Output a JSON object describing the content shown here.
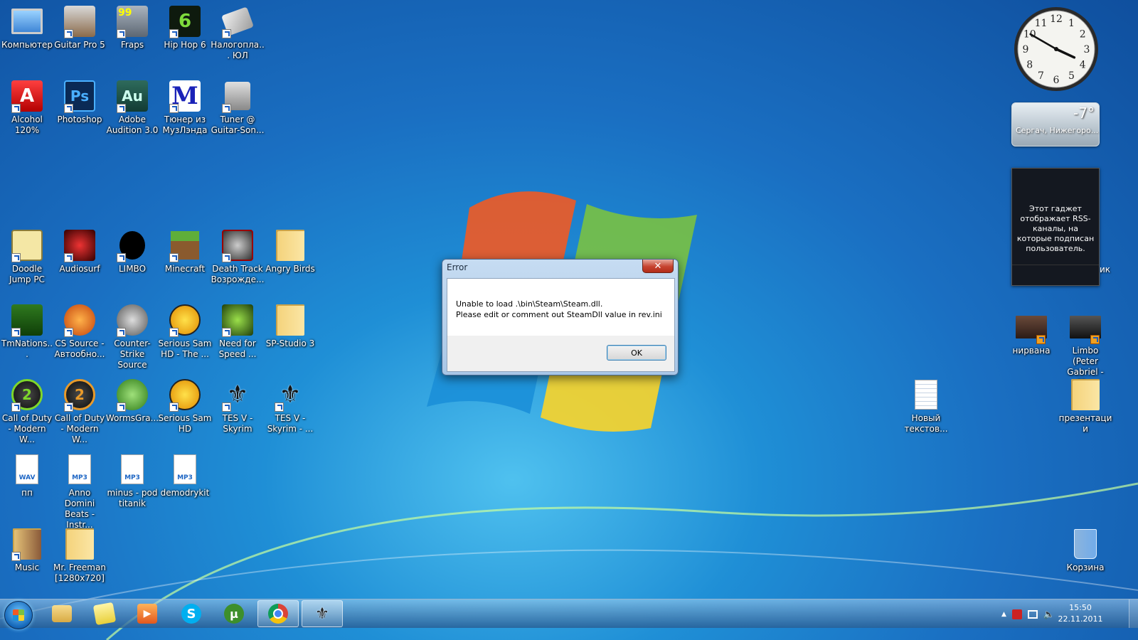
{
  "desktop": {
    "icons": [
      {
        "label": "Компьютер"
      },
      {
        "label": "Guitar Pro 5"
      },
      {
        "label": "Fraps"
      },
      {
        "label": "Hip Hop 6"
      },
      {
        "label": "Налогопла... ЮЛ"
      },
      {
        "label": "Alcohol 120%"
      },
      {
        "label": "Photoshop"
      },
      {
        "label": "Adobe Audition 3.0"
      },
      {
        "label": "Тюнер из МузЛэнда"
      },
      {
        "label": "Tuner @ Guitar-Son..."
      },
      {
        "label": "Doodle Jump PC"
      },
      {
        "label": "Audiosurf"
      },
      {
        "label": "LIMBO"
      },
      {
        "label": "Minecraft"
      },
      {
        "label": "Death Track Возрожде..."
      },
      {
        "label": "Angry Birds"
      },
      {
        "label": "TmNations..."
      },
      {
        "label": "CS Source - Автообно..."
      },
      {
        "label": "Counter-Strike Source"
      },
      {
        "label": "Serious Sam HD - The ..."
      },
      {
        "label": "Need for Speed ..."
      },
      {
        "label": "SP-Studio 3"
      },
      {
        "label": "Call of Duty - Modern W..."
      },
      {
        "label": "Call of Duty - Modern W..."
      },
      {
        "label": "WormsGra..."
      },
      {
        "label": "Serious Sam HD"
      },
      {
        "label": "TES V - Skyrim"
      },
      {
        "label": "TES V - Skyrim - ..."
      },
      {
        "label": "пп"
      },
      {
        "label": "Anno Domini Beats - Instr..."
      },
      {
        "label": "minus - pod titanik"
      },
      {
        "label": "demodrykit"
      },
      {
        "label": "Music"
      },
      {
        "label": "Mr. Freeman [1280x720]"
      },
      {
        "label": "нирвана"
      },
      {
        "label": "Limbo (Peter Gabriel - M..."
      },
      {
        "label": "Новый текстов..."
      },
      {
        "label": "презентации"
      },
      {
        "label": "Корзина"
      }
    ],
    "file_badges": {
      "wav": "WAV",
      "mp3": "MP3"
    },
    "photoshop_glyph": "Ps",
    "audition_glyph": "Au",
    "hiphop_glyph": "6",
    "fraps_glyph": "99",
    "tuner_glyph": "M"
  },
  "gadgets": {
    "clock": {
      "hour": 3,
      "minute": 50,
      "numerals": [
        "12",
        "1",
        "2",
        "3",
        "4",
        "5",
        "6",
        "7",
        "8",
        "9",
        "10",
        "11"
      ]
    },
    "weather": {
      "temperature": "-7°",
      "location": "Сергач, Нижегоро..."
    },
    "rss": {
      "text": "Этот гаджет отображает RSS-каналы, на которые подписан пользователь.",
      "side_fragment": "ик"
    }
  },
  "dialog": {
    "title": "Error",
    "close_glyph": "✕",
    "message_line1": "Unable to load .\\bin\\Steam\\Steam.dll.",
    "message_line2": "Please edit or comment out SteamDll value in rev.ini",
    "ok_label": "OK"
  },
  "taskbar": {
    "time": "15:50",
    "date": "22.11.2011",
    "tray_arrow": "▲"
  },
  "colors": {
    "desktop_blue": "#1a6fc2",
    "dialog_frame": "#a8c6e6",
    "close_red": "#c6432f"
  }
}
